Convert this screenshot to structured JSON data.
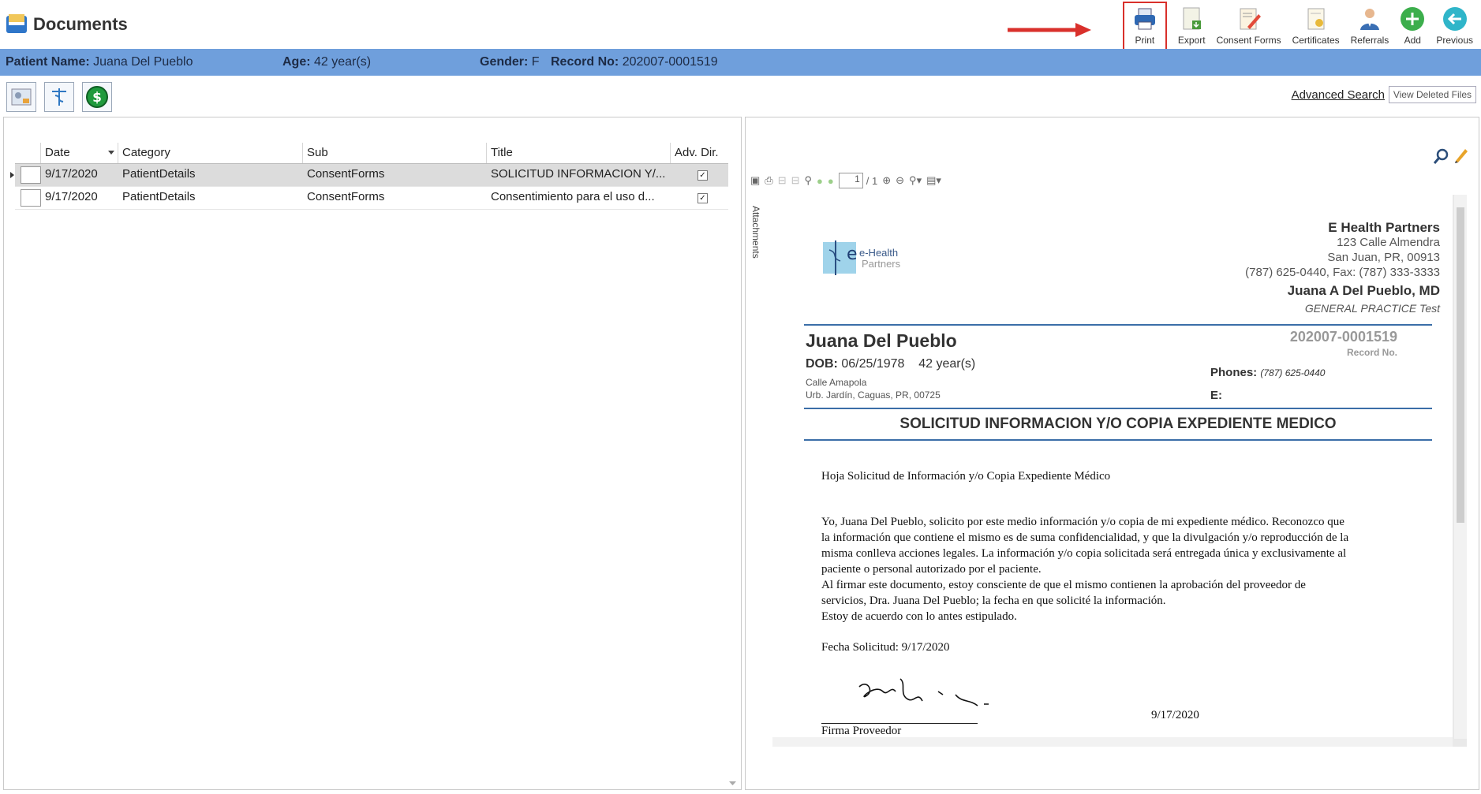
{
  "app": {
    "title": "Documents"
  },
  "toolbar": {
    "print": "Print",
    "export": "Export",
    "consent_forms": "Consent Forms",
    "certificates": "Certificates",
    "referrals": "Referrals",
    "add": "Add",
    "previous": "Previous"
  },
  "patient": {
    "name_label": "Patient Name:",
    "name": "Juana Del Pueblo",
    "age_label": "Age:",
    "age": "42 year(s)",
    "gender_label": "Gender:",
    "gender": "F",
    "record_label": "Record No:",
    "record": "202007-0001519"
  },
  "links": {
    "advanced_search": "Advanced Search",
    "view_deleted": "View Deleted Files"
  },
  "grid": {
    "columns": [
      "Date",
      "Category",
      "Sub",
      "Title",
      "Adv. Dir."
    ],
    "rows": [
      {
        "date": "9/17/2020",
        "category": "PatientDetails",
        "sub": "ConsentForms",
        "title": "SOLICITUD INFORMACION Y/...",
        "adv": true
      },
      {
        "date": "9/17/2020",
        "category": "PatientDetails",
        "sub": "ConsentForms",
        "title": "Consentimiento para el uso d...",
        "adv": true
      }
    ]
  },
  "viewer": {
    "page_current": "1",
    "page_total": "/ 1",
    "attachments": "Attachments"
  },
  "doc": {
    "practice": "E Health Partners",
    "address1": "123 Calle Almendra",
    "address2": "San Juan, PR, 00913",
    "phone_fax": "(787) 625-0440, Fax: (787) 333-3333",
    "doctor": "Juana A Del Pueblo, MD",
    "specialty": "GENERAL PRACTICE Test",
    "logo_text1": "e-Health",
    "logo_text2": "Partners",
    "patient_name": "Juana Del Pueblo",
    "dob_label": "DOB:",
    "dob": "06/25/1978",
    "age": "42 year(s)",
    "street": "Calle Amapola",
    "city": "Urb. Jardín, Caguas, PR, 00725",
    "record": "202007-0001519",
    "record_label": "Record No.",
    "phones_label": "Phones:",
    "phones": "(787) 625-0440",
    "email_label": "E:",
    "heading": "SOLICITUD INFORMACION Y/O COPIA EXPEDIENTE MEDICO",
    "subtitle": "Hoja Solicitud de Información y/o Copia Expediente Médico",
    "body": [
      "Yo, Juana Del Pueblo, solicito por este medio información y/o copia de mi expediente médico. Reconozco que",
      "la información que contiene el mismo es de suma confidencialidad, y que la divulgación y/o reproducción de la",
      "misma conlleva acciones legales. La información y/o copia solicitada será entregada única y exclusivamente al",
      "paciente o personal autorizado por el paciente.",
      "Al firmar este documento, estoy consciente de que el mismo contienen la aprobación del proveedor de",
      "servicios, Dra. Juana Del Pueblo; la fecha en que solicité la información.",
      "Estoy de acuerdo con lo antes estipulado."
    ],
    "request_date": "Fecha Solicitud: 9/17/2020",
    "sign_date": "9/17/2020",
    "sign_label": "Firma Proveedor"
  },
  "colors": {
    "info_bar": "#6f9fdc",
    "accent_green": "#3cae4c",
    "accent_teal": "#2fb5c9",
    "highlight_red": "#d9302b",
    "doc_rule": "#3b6ea8"
  }
}
